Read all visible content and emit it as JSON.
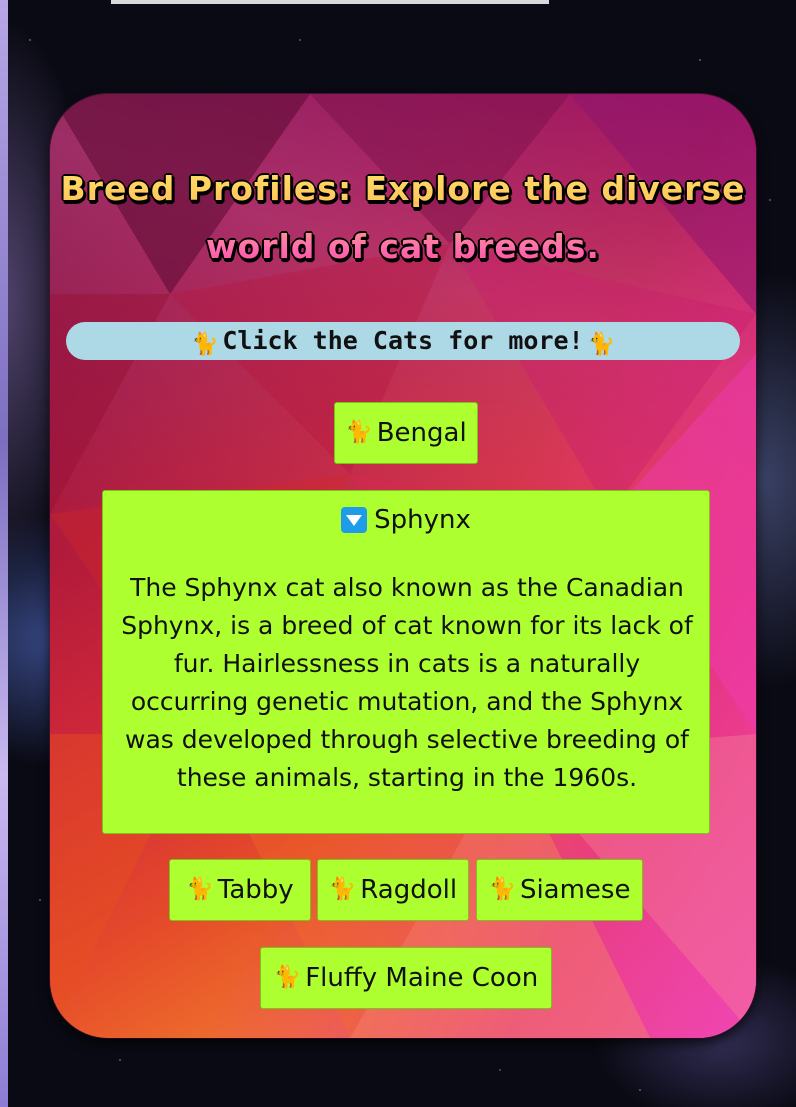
{
  "page": {
    "title": "Breed Profiles: Explore the diverse world of cat breeds."
  },
  "banner": {
    "text": "Click the Cats for more!",
    "icon": "cat-emoji"
  },
  "breeds": {
    "bengal": {
      "label": "Bengal",
      "icon": "cat-emoji"
    },
    "sphynx": {
      "label": "Sphynx",
      "icon": "down-arrow-emoji",
      "expanded": true,
      "description": "The Sphynx cat also known as the Canadian Sphynx, is a breed of cat known for its lack of fur. Hairlessness in cats is a naturally occurring genetic mutation, and the Sphynx was developed through selective breeding of these animals, starting in the 1960s."
    },
    "tabby": {
      "label": "Tabby",
      "icon": "cat-emoji"
    },
    "ragdoll": {
      "label": "Ragdoll",
      "icon": "cat-emoji"
    },
    "siamese": {
      "label": "Siamese",
      "icon": "cat-emoji"
    },
    "maine_coon": {
      "label": "Fluffy Maine Coon",
      "icon": "cat-emoji"
    }
  },
  "colors": {
    "button_bg": "#adff2f",
    "banner_bg": "#add8e6",
    "down_icon": "#1e9be9"
  }
}
